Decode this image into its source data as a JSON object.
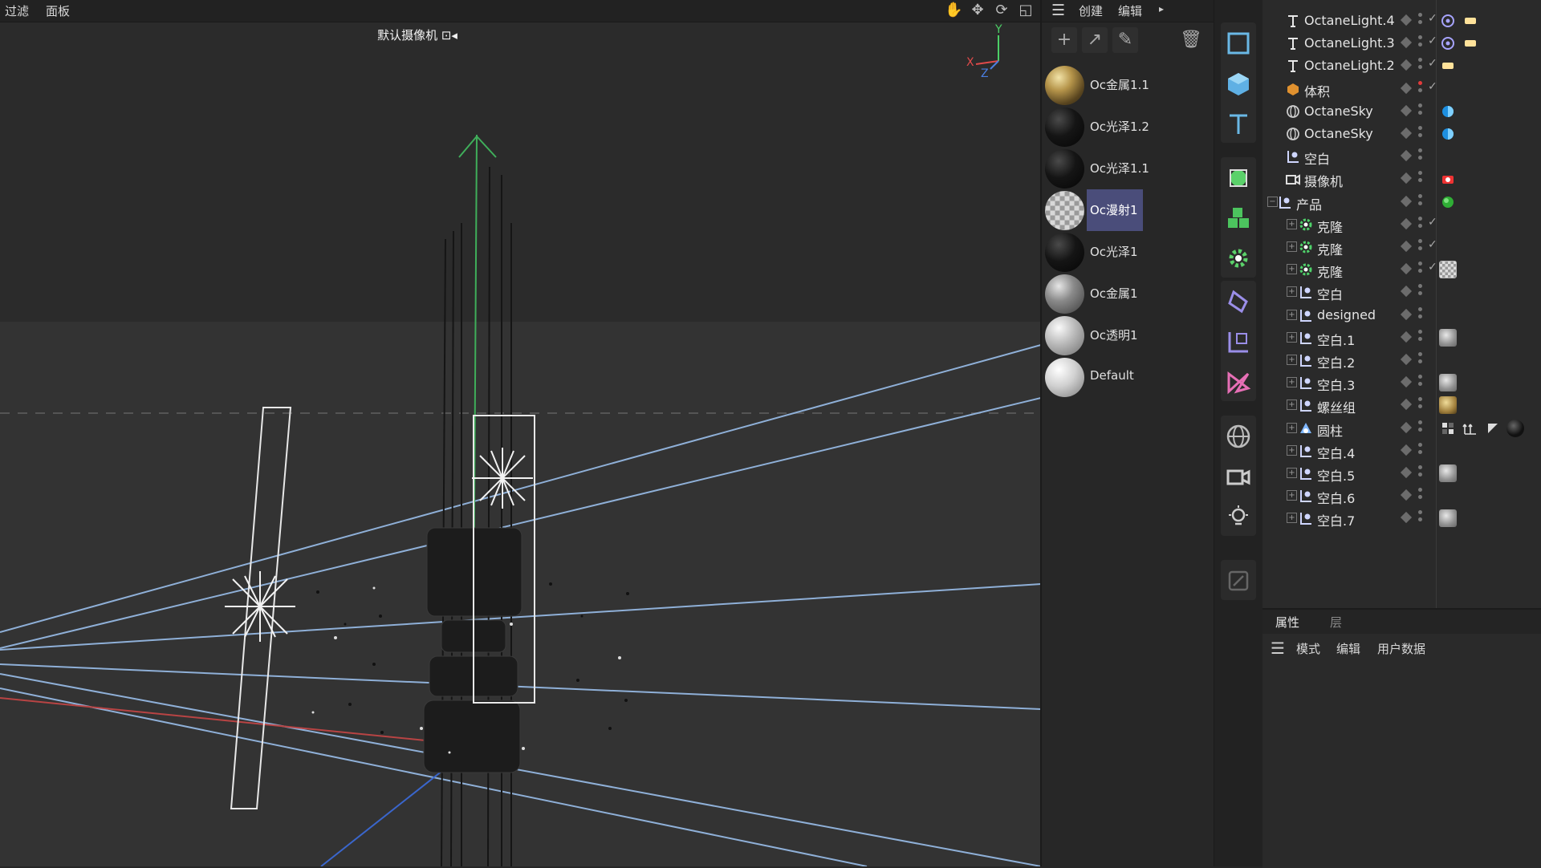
{
  "viewport": {
    "menu": [
      "过滤",
      "面板"
    ],
    "camera_label": "默认摄像机 ⊡◂",
    "axis": {
      "x": "X",
      "y": "Y",
      "z": "Z"
    },
    "tools": [
      "hand-icon",
      "move-icon",
      "rotate-icon",
      "maximize-icon"
    ]
  },
  "materials": {
    "menu": [
      "创建",
      "编辑"
    ],
    "toolbar": [
      "add-icon",
      "arrow-icon",
      "pen-icon",
      "trash-icon"
    ],
    "items": [
      {
        "name": "Oc金属1.1",
        "ball": "gold"
      },
      {
        "name": "Oc光泽1.2",
        "ball": "black"
      },
      {
        "name": "Oc光泽1.1",
        "ball": "black"
      },
      {
        "name": "Oc漫射1",
        "ball": "checker",
        "selected": true
      },
      {
        "name": "Oc光泽1",
        "ball": "black"
      },
      {
        "name": "Oc金属1",
        "ball": "grey"
      },
      {
        "name": "Oc透明1",
        "ball": "lightgrey"
      },
      {
        "name": "Default",
        "ball": "white"
      }
    ]
  },
  "toolbar": {
    "tools": [
      "square-icon",
      "cube-icon",
      "text-icon",
      "subdivision-icon",
      "cloner-icon",
      "effector-icon",
      "deformer-icon",
      "null-object-icon",
      "spline-icon",
      "sky-icon",
      "camera-icon",
      "light-icon",
      "paint-icon"
    ]
  },
  "objects": [
    {
      "name": "OctaneLight.4",
      "icon": "light",
      "indent": 1,
      "check": true,
      "tags": [
        "target",
        "lighttag"
      ]
    },
    {
      "name": "OctaneLight.3",
      "icon": "light",
      "indent": 1,
      "check": true,
      "tags": [
        "target",
        "lighttag"
      ]
    },
    {
      "name": "OctaneLight.2",
      "icon": "light",
      "indent": 1,
      "check": true,
      "tags": [
        "lighttag"
      ]
    },
    {
      "name": "体积",
      "icon": "volume",
      "indent": 1,
      "check": true,
      "red": true,
      "tags": []
    },
    {
      "name": "OctaneSky",
      "icon": "sky",
      "indent": 1,
      "check": false,
      "tags": [
        "skytag"
      ]
    },
    {
      "name": "OctaneSky",
      "icon": "sky",
      "indent": 1,
      "check": false,
      "tags": [
        "skytag"
      ]
    },
    {
      "name": "空白",
      "icon": "null",
      "indent": 1,
      "check": false,
      "tags": []
    },
    {
      "name": "摄像机",
      "icon": "camera",
      "indent": 1,
      "check": false,
      "tags": [
        "cameratag"
      ]
    },
    {
      "name": "产品",
      "icon": "null",
      "indent": 0,
      "expand": "−",
      "check": false,
      "tags": [
        "greenball"
      ]
    },
    {
      "name": "克隆",
      "icon": "cloner",
      "indent": 2,
      "expand": "+",
      "check": true,
      "tags": []
    },
    {
      "name": "克隆",
      "icon": "cloner",
      "indent": 2,
      "expand": "+",
      "check": true,
      "tags": []
    },
    {
      "name": "克隆",
      "icon": "cloner",
      "indent": 2,
      "expand": "+",
      "check": true,
      "tags": [
        "checker"
      ]
    },
    {
      "name": "空白",
      "icon": "null",
      "indent": 2,
      "expand": "+",
      "check": false,
      "tags": []
    },
    {
      "name": "designed",
      "icon": "null",
      "indent": 2,
      "expand": "+",
      "check": false,
      "tags": []
    },
    {
      "name": "空白.1",
      "icon": "null",
      "indent": 2,
      "expand": "+",
      "check": false,
      "tags": [
        "greyball"
      ]
    },
    {
      "name": "空白.2",
      "icon": "null",
      "indent": 2,
      "expand": "+",
      "check": false,
      "tags": []
    },
    {
      "name": "空白.3",
      "icon": "null",
      "indent": 2,
      "expand": "+",
      "check": false,
      "tags": [
        "greyball"
      ]
    },
    {
      "name": "螺丝组",
      "icon": "null",
      "indent": 2,
      "expand": "+",
      "check": false,
      "tags": [
        "goldball"
      ]
    },
    {
      "name": "圆柱",
      "icon": "cylinder",
      "indent": 2,
      "expand": "+",
      "check": false,
      "tags": [
        "phong",
        "uvw",
        "select",
        "blackball"
      ]
    },
    {
      "name": "空白.4",
      "icon": "null",
      "indent": 2,
      "expand": "+",
      "check": false,
      "tags": []
    },
    {
      "name": "空白.5",
      "icon": "null",
      "indent": 2,
      "expand": "+",
      "check": false,
      "tags": [
        "greyball"
      ]
    },
    {
      "name": "空白.6",
      "icon": "null",
      "indent": 2,
      "expand": "+",
      "check": false,
      "tags": []
    },
    {
      "name": "空白.7",
      "icon": "null",
      "indent": 2,
      "expand": "+",
      "check": false,
      "tags": [
        "greyball"
      ]
    }
  ],
  "attributes": {
    "tabs": [
      "属性",
      "层"
    ],
    "menu": [
      "模式",
      "编辑",
      "用户数据"
    ]
  }
}
